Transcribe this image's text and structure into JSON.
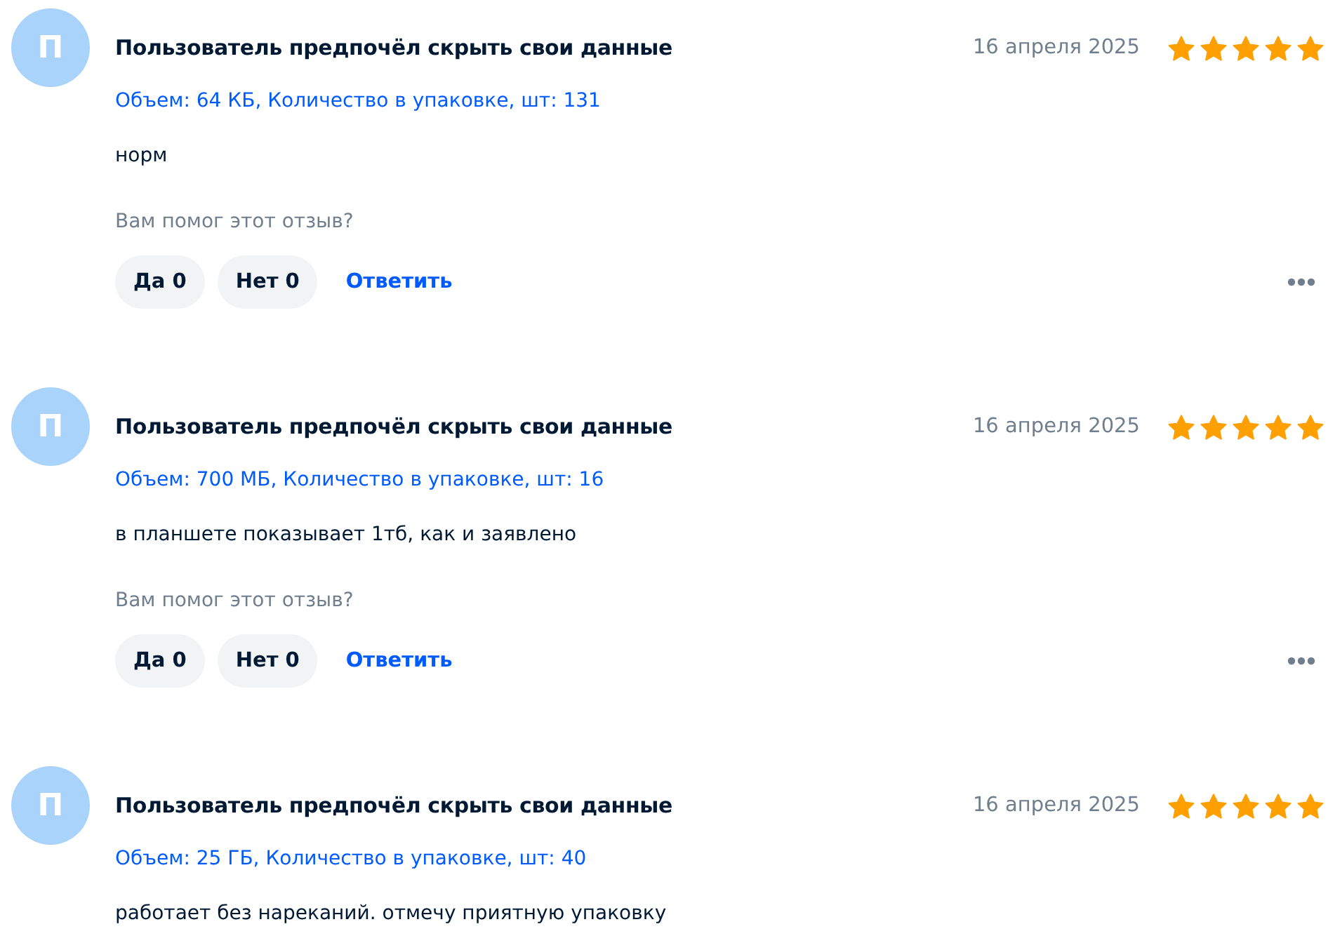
{
  "reviews": [
    {
      "avatar_letter": "П",
      "author": "Пользователь предпочёл скрыть свои данные",
      "date": "16 апреля 2025",
      "stars": 5,
      "variant": "Объем: 64 КБ, Количество в упаковке, шт: 131",
      "text": "норм",
      "helpful_question": "Вам помог этот отзыв?",
      "votes": [
        {
          "label": "Да 0"
        },
        {
          "label": "Нет 0"
        }
      ],
      "reply": "Ответить"
    },
    {
      "avatar_letter": "П",
      "author": "Пользователь предпочёл скрыть свои данные",
      "date": "16 апреля 2025",
      "stars": 5,
      "variant": "Объем: 700 МБ, Количество в упаковке, шт: 16",
      "text": "в планшете показывает 1тб, как и заявлено",
      "helpful_question": "Вам помог этот отзыв?",
      "votes": [
        {
          "label": "Да 0"
        },
        {
          "label": "Нет 0"
        }
      ],
      "reply": "Ответить"
    },
    {
      "avatar_letter": "П",
      "author": "Пользователь предпочёл скрыть свои данные",
      "date": "16 апреля 2025",
      "stars": 5,
      "variant": "Объем: 25 ГБ, Количество в упаковке, шт: 40",
      "text": "работает без нареканий. отмечу приятную упаковку"
    }
  ]
}
